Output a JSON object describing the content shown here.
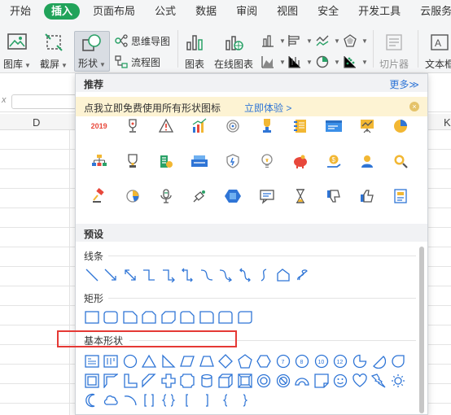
{
  "menu": {
    "items": [
      "开始",
      "插入",
      "页面布局",
      "公式",
      "数据",
      "审阅",
      "视图",
      "安全",
      "开发工具",
      "云服务"
    ],
    "active": "插入"
  },
  "ribbon": {
    "picture_library": "图库",
    "screenshot": "截屏",
    "shapes": "形状",
    "mindmap": "思维导图",
    "flowchart": "流程图",
    "chart": "图表",
    "online_chart": "在线图表",
    "slicer": "切片器",
    "textbox": "文本框"
  },
  "sheet": {
    "fx_label": "x",
    "columns": [
      "D",
      "K"
    ]
  },
  "panel": {
    "recommended_title": "推荐",
    "more_link": "更多≫",
    "promo_text": "点我立即免费使用所有形状图标",
    "promo_link": "立即体验 >",
    "rec_icons": [
      [
        "year-2019-icon",
        "trophy-icon",
        "warning-icon",
        "bar-chart-growth-icon",
        "target-icon",
        "medal-icon",
        "notebook-icon",
        "browser-window-icon",
        "presentation-icon",
        "pie-chart-icon"
      ],
      [
        "org-chart-icon",
        "cup-icon",
        "building-coin-icon",
        "cashier-icon",
        "shield-icon",
        "lightbulb-icon",
        "piggy-bank-icon",
        "money-hand-icon",
        "user-icon",
        "search-zoom-icon"
      ],
      [
        "gavel-icon",
        "pie-slice-icon",
        "microphone-icon",
        "satellite-icon",
        "chip-icon",
        "chat-bubble-icon",
        "hourglass-icon",
        "thumbs-down-icon",
        "thumbs-up-icon",
        "document-icon"
      ]
    ],
    "year_text": "2019",
    "preset_title": "预设",
    "lines_label": "线条",
    "rect_label": "矩形",
    "basic_label": "基本形状"
  }
}
